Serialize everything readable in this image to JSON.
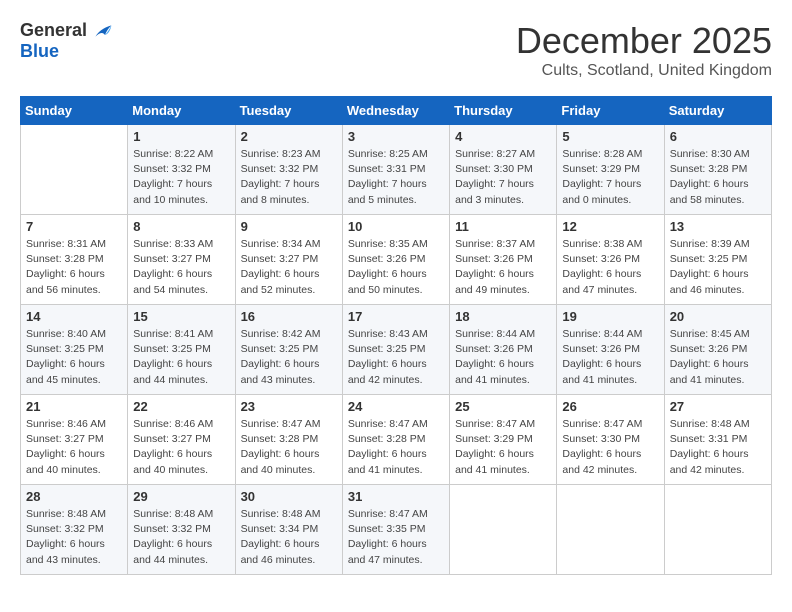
{
  "logo": {
    "general": "General",
    "blue": "Blue"
  },
  "title": "December 2025",
  "subtitle": "Cults, Scotland, United Kingdom",
  "days_header": [
    "Sunday",
    "Monday",
    "Tuesday",
    "Wednesday",
    "Thursday",
    "Friday",
    "Saturday"
  ],
  "weeks": [
    [
      {
        "day": "",
        "info": ""
      },
      {
        "day": "1",
        "info": "Sunrise: 8:22 AM\nSunset: 3:32 PM\nDaylight: 7 hours\nand 10 minutes."
      },
      {
        "day": "2",
        "info": "Sunrise: 8:23 AM\nSunset: 3:32 PM\nDaylight: 7 hours\nand 8 minutes."
      },
      {
        "day": "3",
        "info": "Sunrise: 8:25 AM\nSunset: 3:31 PM\nDaylight: 7 hours\nand 5 minutes."
      },
      {
        "day": "4",
        "info": "Sunrise: 8:27 AM\nSunset: 3:30 PM\nDaylight: 7 hours\nand 3 minutes."
      },
      {
        "day": "5",
        "info": "Sunrise: 8:28 AM\nSunset: 3:29 PM\nDaylight: 7 hours\nand 0 minutes."
      },
      {
        "day": "6",
        "info": "Sunrise: 8:30 AM\nSunset: 3:28 PM\nDaylight: 6 hours\nand 58 minutes."
      }
    ],
    [
      {
        "day": "7",
        "info": "Sunrise: 8:31 AM\nSunset: 3:28 PM\nDaylight: 6 hours\nand 56 minutes."
      },
      {
        "day": "8",
        "info": "Sunrise: 8:33 AM\nSunset: 3:27 PM\nDaylight: 6 hours\nand 54 minutes."
      },
      {
        "day": "9",
        "info": "Sunrise: 8:34 AM\nSunset: 3:27 PM\nDaylight: 6 hours\nand 52 minutes."
      },
      {
        "day": "10",
        "info": "Sunrise: 8:35 AM\nSunset: 3:26 PM\nDaylight: 6 hours\nand 50 minutes."
      },
      {
        "day": "11",
        "info": "Sunrise: 8:37 AM\nSunset: 3:26 PM\nDaylight: 6 hours\nand 49 minutes."
      },
      {
        "day": "12",
        "info": "Sunrise: 8:38 AM\nSunset: 3:26 PM\nDaylight: 6 hours\nand 47 minutes."
      },
      {
        "day": "13",
        "info": "Sunrise: 8:39 AM\nSunset: 3:25 PM\nDaylight: 6 hours\nand 46 minutes."
      }
    ],
    [
      {
        "day": "14",
        "info": "Sunrise: 8:40 AM\nSunset: 3:25 PM\nDaylight: 6 hours\nand 45 minutes."
      },
      {
        "day": "15",
        "info": "Sunrise: 8:41 AM\nSunset: 3:25 PM\nDaylight: 6 hours\nand 44 minutes."
      },
      {
        "day": "16",
        "info": "Sunrise: 8:42 AM\nSunset: 3:25 PM\nDaylight: 6 hours\nand 43 minutes."
      },
      {
        "day": "17",
        "info": "Sunrise: 8:43 AM\nSunset: 3:25 PM\nDaylight: 6 hours\nand 42 minutes."
      },
      {
        "day": "18",
        "info": "Sunrise: 8:44 AM\nSunset: 3:26 PM\nDaylight: 6 hours\nand 41 minutes."
      },
      {
        "day": "19",
        "info": "Sunrise: 8:44 AM\nSunset: 3:26 PM\nDaylight: 6 hours\nand 41 minutes."
      },
      {
        "day": "20",
        "info": "Sunrise: 8:45 AM\nSunset: 3:26 PM\nDaylight: 6 hours\nand 41 minutes."
      }
    ],
    [
      {
        "day": "21",
        "info": "Sunrise: 8:46 AM\nSunset: 3:27 PM\nDaylight: 6 hours\nand 40 minutes."
      },
      {
        "day": "22",
        "info": "Sunrise: 8:46 AM\nSunset: 3:27 PM\nDaylight: 6 hours\nand 40 minutes."
      },
      {
        "day": "23",
        "info": "Sunrise: 8:47 AM\nSunset: 3:28 PM\nDaylight: 6 hours\nand 40 minutes."
      },
      {
        "day": "24",
        "info": "Sunrise: 8:47 AM\nSunset: 3:28 PM\nDaylight: 6 hours\nand 41 minutes."
      },
      {
        "day": "25",
        "info": "Sunrise: 8:47 AM\nSunset: 3:29 PM\nDaylight: 6 hours\nand 41 minutes."
      },
      {
        "day": "26",
        "info": "Sunrise: 8:47 AM\nSunset: 3:30 PM\nDaylight: 6 hours\nand 42 minutes."
      },
      {
        "day": "27",
        "info": "Sunrise: 8:48 AM\nSunset: 3:31 PM\nDaylight: 6 hours\nand 42 minutes."
      }
    ],
    [
      {
        "day": "28",
        "info": "Sunrise: 8:48 AM\nSunset: 3:32 PM\nDaylight: 6 hours\nand 43 minutes."
      },
      {
        "day": "29",
        "info": "Sunrise: 8:48 AM\nSunset: 3:32 PM\nDaylight: 6 hours\nand 44 minutes."
      },
      {
        "day": "30",
        "info": "Sunrise: 8:48 AM\nSunset: 3:34 PM\nDaylight: 6 hours\nand 46 minutes."
      },
      {
        "day": "31",
        "info": "Sunrise: 8:47 AM\nSunset: 3:35 PM\nDaylight: 6 hours\nand 47 minutes."
      },
      {
        "day": "",
        "info": ""
      },
      {
        "day": "",
        "info": ""
      },
      {
        "day": "",
        "info": ""
      }
    ]
  ]
}
